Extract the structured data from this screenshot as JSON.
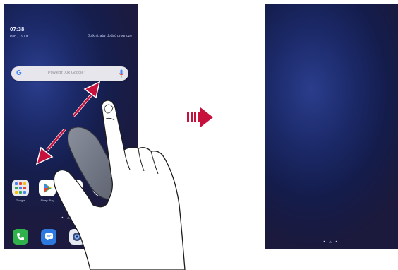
{
  "left_screen": {
    "clock": "07:38",
    "date": "Pon., 19 lut.",
    "weather_text": "Dotknij, aby dodać prognozę",
    "search": {
      "google_letter": "G",
      "hint": "Powiedz „Ok Google”"
    },
    "apps": [
      {
        "label": "Google",
        "icon": "google-folder-icon"
      },
      {
        "label": "Sklep Play",
        "icon": "play-store-icon"
      },
      {
        "label": "Gallery",
        "icon": "gallery-icon"
      },
      {
        "label": "",
        "icon": "messenger-icon"
      }
    ],
    "page_indicator": "• ⌂ •",
    "dock": [
      {
        "icon": "phone-icon"
      },
      {
        "icon": "messages-icon"
      },
      {
        "icon": "camera-icon"
      },
      {
        "icon": "photos-icon"
      }
    ]
  },
  "right_screen": {
    "page_indicator": "• ⌂ •"
  },
  "gesture": {
    "type": "pinch-in",
    "transition_arrow": "right-arrow-icon"
  },
  "colors": {
    "arrow_accent": "#c8103c",
    "wallpaper_dark": "#151e4d",
    "wallpaper_light": "#2c3f8f"
  }
}
